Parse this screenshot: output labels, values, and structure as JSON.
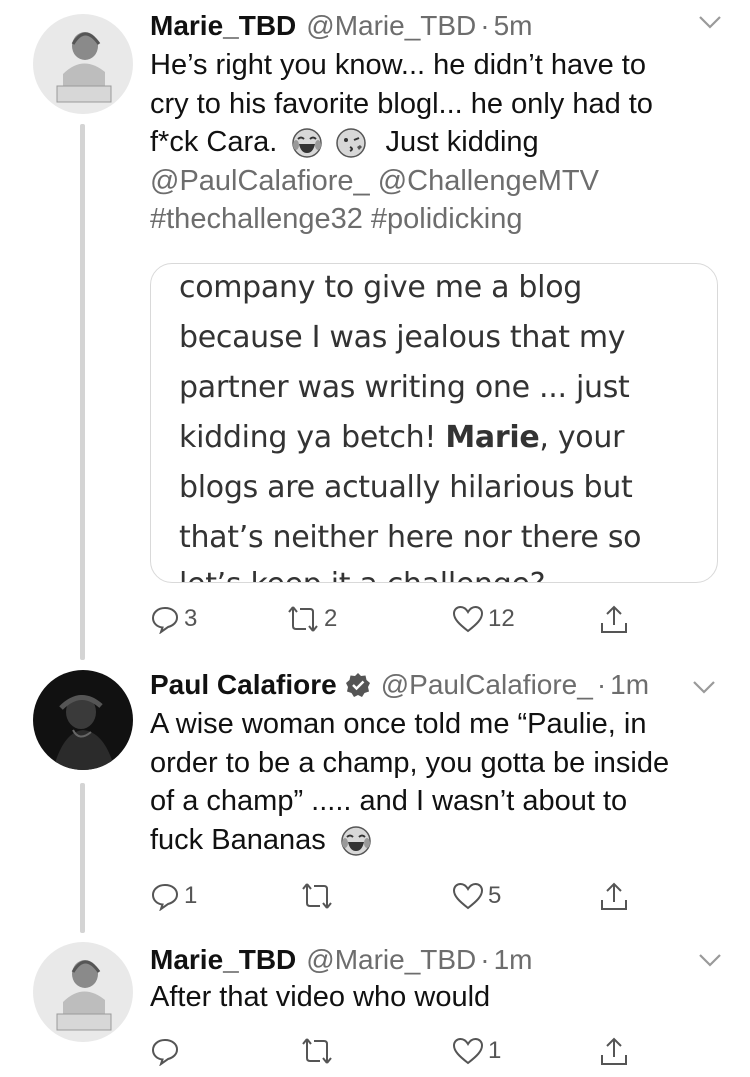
{
  "tweets": [
    {
      "name": "Marie_TBD",
      "handle": "@Marie_TBD",
      "time": "5m",
      "text_lines": [
        "He’s right you know... he didn’t have to",
        "cry to his favorite blogl... he only had to",
        "f*ck Cara."
      ],
      "text_after_emoji": "Just kidding",
      "mentions_line": "@PaulCalafiore_ @ChallengeMTV",
      "hashtags_line": "#thechallenge32 #polidicking",
      "quote_lines": [
        "company to give me a blog",
        "because I was jealous that my",
        "partner was writing one ... just",
        "kidding ya betch! ",
        "blogs are actually hilarious but",
        "that’s neither here nor there so",
        "let’s keep it a challenge?"
      ],
      "quote_bold": "Marie",
      "quote_after_bold": ", your",
      "replies": "3",
      "retweets": "2",
      "likes": "12"
    },
    {
      "name": "Paul Calafiore",
      "handle": "@PaulCalafiore_",
      "time": "1m",
      "text_lines": [
        "A wise woman once told me “Paulie, in",
        "order to be a champ, you gotta be inside",
        "of a champ” ..... and I wasn’t about to",
        "fuck Bananas"
      ],
      "replies": "1",
      "retweets": "",
      "likes": "5"
    },
    {
      "name": "Marie_TBD",
      "handle": "@Marie_TBD",
      "time": "1m",
      "text_lines": [
        "After that video who would"
      ],
      "replies": "",
      "retweets": "",
      "likes": "1"
    }
  ],
  "dot": "·",
  "icons": [
    "reply-icon",
    "retweet-icon",
    "like-icon",
    "share-icon",
    "chevron-down-icon",
    "verified-badge-icon",
    "laughing-emoji-icon",
    "kissing-emoji-icon"
  ]
}
